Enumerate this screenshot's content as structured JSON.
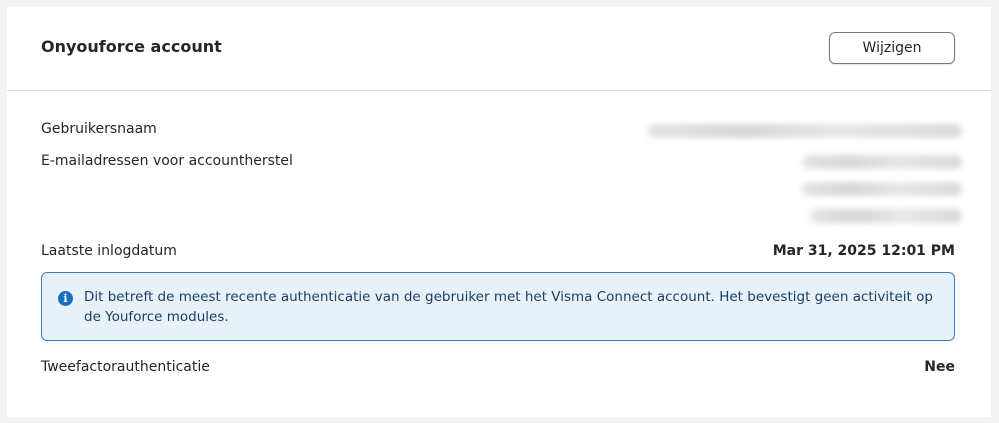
{
  "account": {
    "title": "Onyouforce account",
    "edit_label": "Wijzigen"
  },
  "fields": {
    "username_label": "Gebruikersnaam",
    "recovery_emails_label": "E-mailadressen voor accountherstel",
    "last_login_label": "Laatste inlogdatum",
    "last_login_value": "Mar 31, 2025 12:01 PM",
    "two_factor_label": "Tweefactorauthenticatie",
    "two_factor_value": "Nee"
  },
  "info": {
    "icon": "info-icon",
    "text": "Dit betreft de meest recente authenticatie van de gebruiker met het Visma Connect account. Het bevestigt geen activiteit op de Youforce modules."
  },
  "colors": {
    "info_border": "#3a7fc1",
    "info_background": "#e6f1fa",
    "info_icon": "#1f6fc0"
  }
}
